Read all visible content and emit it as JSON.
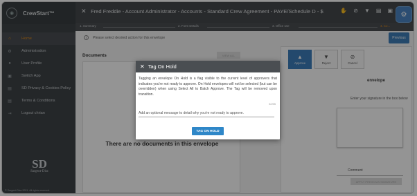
{
  "app": {
    "name": "CrewStart™"
  },
  "header": {
    "title": "Fred Freddie - Account Administrator - Accounts - Standard Crew Agreement - PAYE/Schedule D - $",
    "icons": [
      "hand-icon",
      "block-icon",
      "thumbs-down-icon",
      "document-icon",
      "save-icon"
    ]
  },
  "steps": [
    {
      "label": "1. Summary"
    },
    {
      "label": "2. Form Details"
    },
    {
      "label": "3. Office use"
    },
    {
      "label": "4. Co..."
    }
  ],
  "sidebar": {
    "items": [
      {
        "label": "Home",
        "icon": "home-icon",
        "glyph": "⌂"
      },
      {
        "label": "Administration",
        "icon": "gear-icon",
        "glyph": "⚙"
      },
      {
        "label": "User Profile",
        "icon": "user-icon",
        "glyph": "●"
      },
      {
        "label": "Switch App",
        "icon": "switch-icon",
        "glyph": "▣"
      },
      {
        "label": "SD Privacy & Cookies Policy",
        "icon": "policy-icon",
        "glyph": "▤"
      },
      {
        "label": "Terms & Conditions",
        "icon": "terms-icon",
        "glyph": "▤"
      },
      {
        "label": "Logout chrian",
        "icon": "logout-icon",
        "glyph": "⇥"
      }
    ],
    "logo_letters": "SD",
    "logo_text": "Sargent-Disc",
    "copyright": "© Sargent-Disc 2021. All rights reserved."
  },
  "main": {
    "notice": "Please select desired action for this envelope",
    "previous_label": "Previous",
    "documents_title": "Documents",
    "view_all_label": "VIEW ALL",
    "no_documents": "There are no documents in this envelope",
    "actions": [
      {
        "label": "Approve",
        "icon": "thumbs-up-icon",
        "glyph": "👍"
      },
      {
        "label": "Reject",
        "icon": "thumbs-down-icon",
        "glyph": "👎"
      },
      {
        "label": "Cancel",
        "icon": "cancel-icon",
        "glyph": "⊘"
      }
    ],
    "envelope_label": "envelope",
    "signature_prompt": "Enter your signature in the box below",
    "comment_label": "Comment",
    "apply_label": "APPLY PREVIOUS SIGNATURE"
  },
  "modal": {
    "title": "Tag On Hold",
    "body": "Tagging an envelope On Hold is a flag visible to the current level of approvers that indicates you're not ready to approve. On Hold envelopes will not be selected (but can be overridden) when using Select All to Batch Approve. The Tag will be removed upon transition.",
    "counter": "0/255",
    "message_label": "Add an optional message to detail why you're not ready to approve.",
    "button_label": "TAG ON HOLD"
  },
  "colors": {
    "accent": "#e08a1a",
    "primary_button": "#2f87c8",
    "header_bg": "#45494c",
    "sidebar_bg": "#3f4448"
  }
}
